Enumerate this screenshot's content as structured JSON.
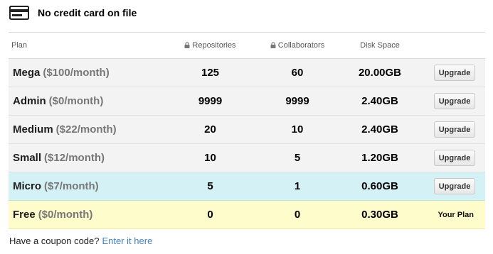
{
  "card": {
    "icon": "credit-card-icon",
    "status_text": "No credit card on file"
  },
  "table": {
    "headers": {
      "plan": "Plan",
      "repositories": "Repositories",
      "collaborators": "Collaborators",
      "disk_space": "Disk Space"
    },
    "lock_icon": "lock-icon",
    "rows": [
      {
        "name": "Mega",
        "price": "($100/month)",
        "repositories": "125",
        "collaborators": "60",
        "disk_space": "20.00GB",
        "action": "Upgrade",
        "state": "normal"
      },
      {
        "name": "Admin",
        "price": "($0/month)",
        "repositories": "9999",
        "collaborators": "9999",
        "disk_space": "2.40GB",
        "action": "Upgrade",
        "state": "normal"
      },
      {
        "name": "Medium",
        "price": "($22/month)",
        "repositories": "20",
        "collaborators": "10",
        "disk_space": "2.40GB",
        "action": "Upgrade",
        "state": "normal"
      },
      {
        "name": "Small",
        "price": "($12/month)",
        "repositories": "10",
        "collaborators": "5",
        "disk_space": "1.20GB",
        "action": "Upgrade",
        "state": "normal"
      },
      {
        "name": "Micro",
        "price": "($7/month)",
        "repositories": "5",
        "collaborators": "1",
        "disk_space": "0.60GB",
        "action": "Upgrade",
        "state": "highlight"
      },
      {
        "name": "Free",
        "price": "($0/month)",
        "repositories": "0",
        "collaborators": "0",
        "disk_space": "0.30GB",
        "action": "Your Plan",
        "state": "current"
      }
    ]
  },
  "coupon": {
    "prompt": "Have a coupon code?",
    "link": "Enter it here"
  },
  "colors": {
    "row_bg": "#f3f3f3",
    "highlight_bg": "#d4f1f5",
    "current_bg": "#fefcca",
    "link": "#4183c4",
    "price_text": "#777777"
  }
}
